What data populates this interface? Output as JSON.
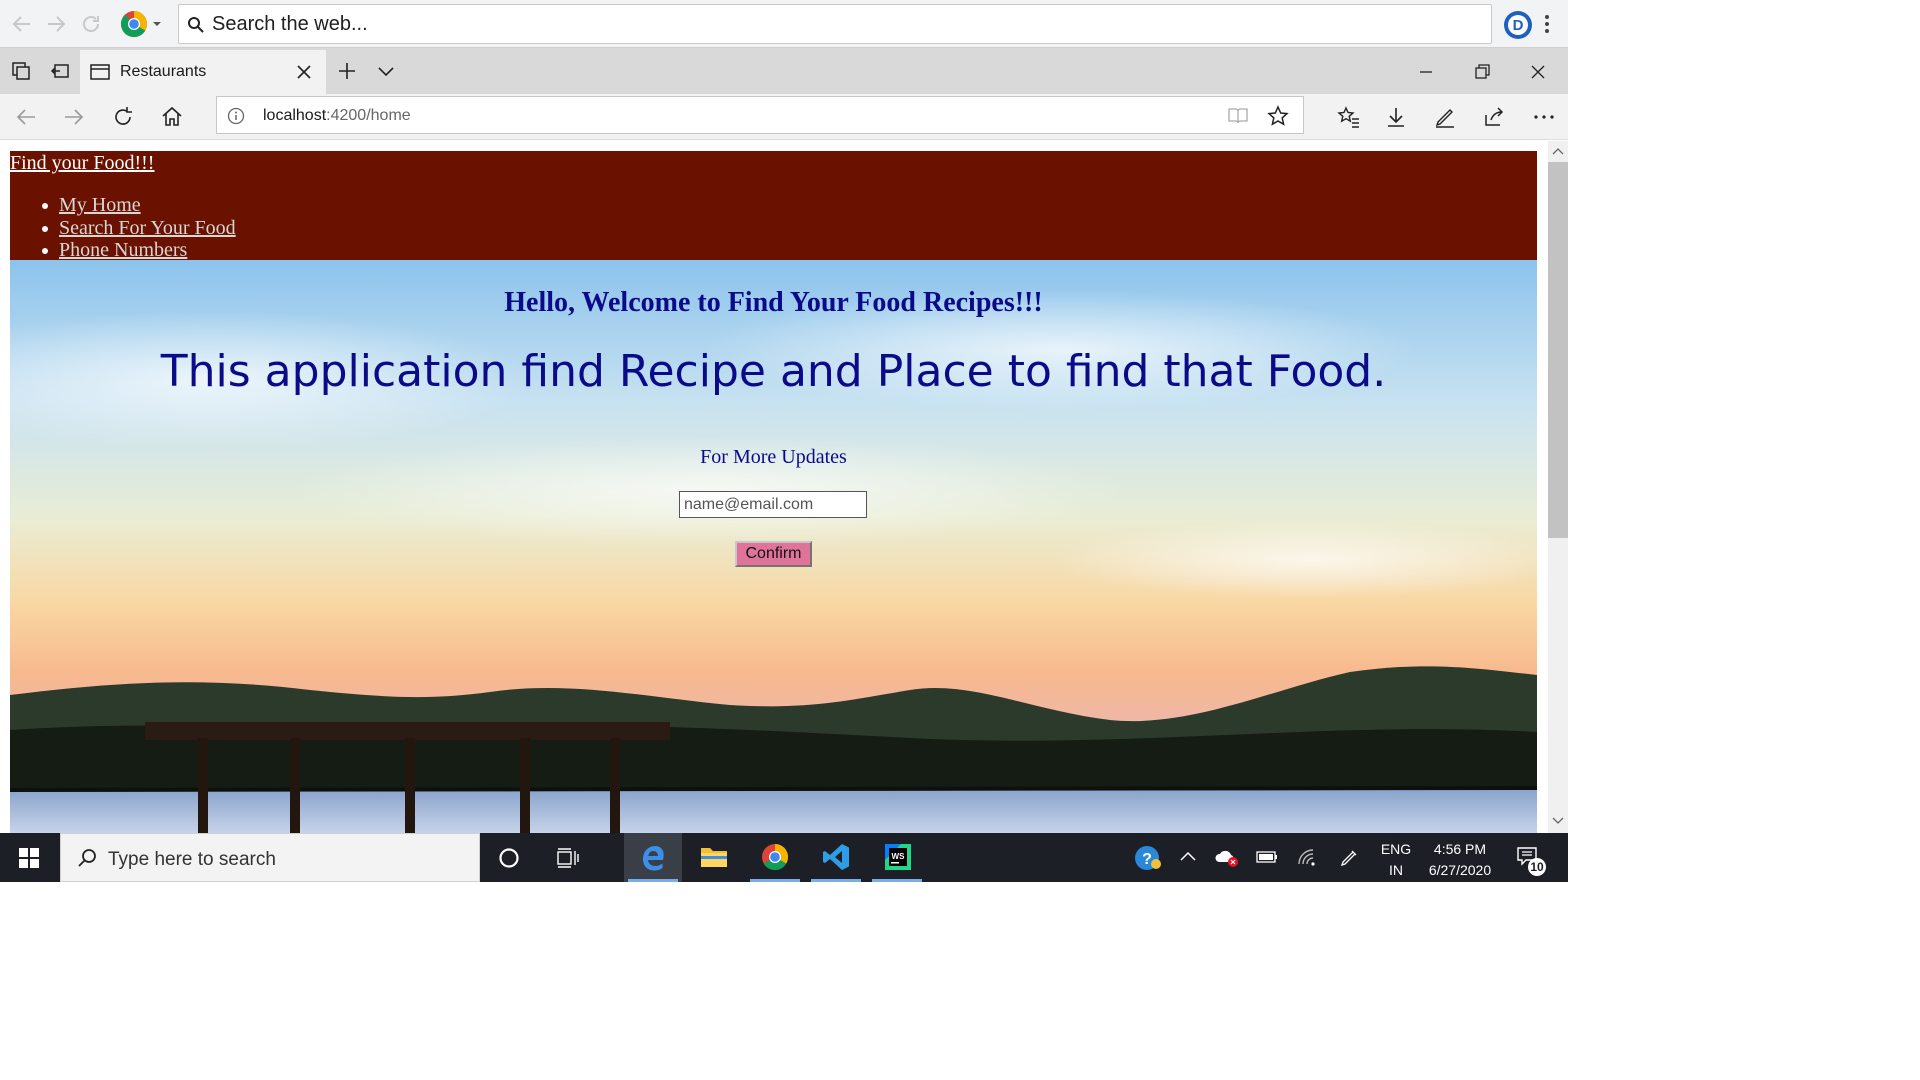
{
  "top_bar": {
    "search_text": "Search the web...",
    "icons": [
      "back-icon",
      "forward-icon",
      "reload-icon",
      "chrome-logo-icon",
      "profile-icon",
      "more-vert-icon"
    ]
  },
  "tab": {
    "title": "Restaurants"
  },
  "address": {
    "host": "localhost",
    "path": ":4200/home"
  },
  "site": {
    "brand": "Find your Food!!!",
    "nav": [
      "My Home",
      "Search For Your Food",
      "Phone Numbers"
    ]
  },
  "hero": {
    "heading": "Hello, Welcome to Find Your Food Recipes!!!",
    "tagline": "This application find Recipe and Place to find that Food.",
    "updates_label": "For More Updates",
    "email_placeholder": "name@email.com",
    "confirm_label": "Confirm"
  },
  "taskbar": {
    "search_placeholder": "Type here to search",
    "lang_line1": "ENG",
    "lang_line2": "IN",
    "time": "4:56 PM",
    "date": "6/27/2020",
    "notification_count": "10"
  },
  "colors": {
    "nav_bg": "#6a1100",
    "heading_text": "#0b0b8a",
    "confirm_button": "#e0739a",
    "taskbar_bg": "#1c1f26"
  }
}
